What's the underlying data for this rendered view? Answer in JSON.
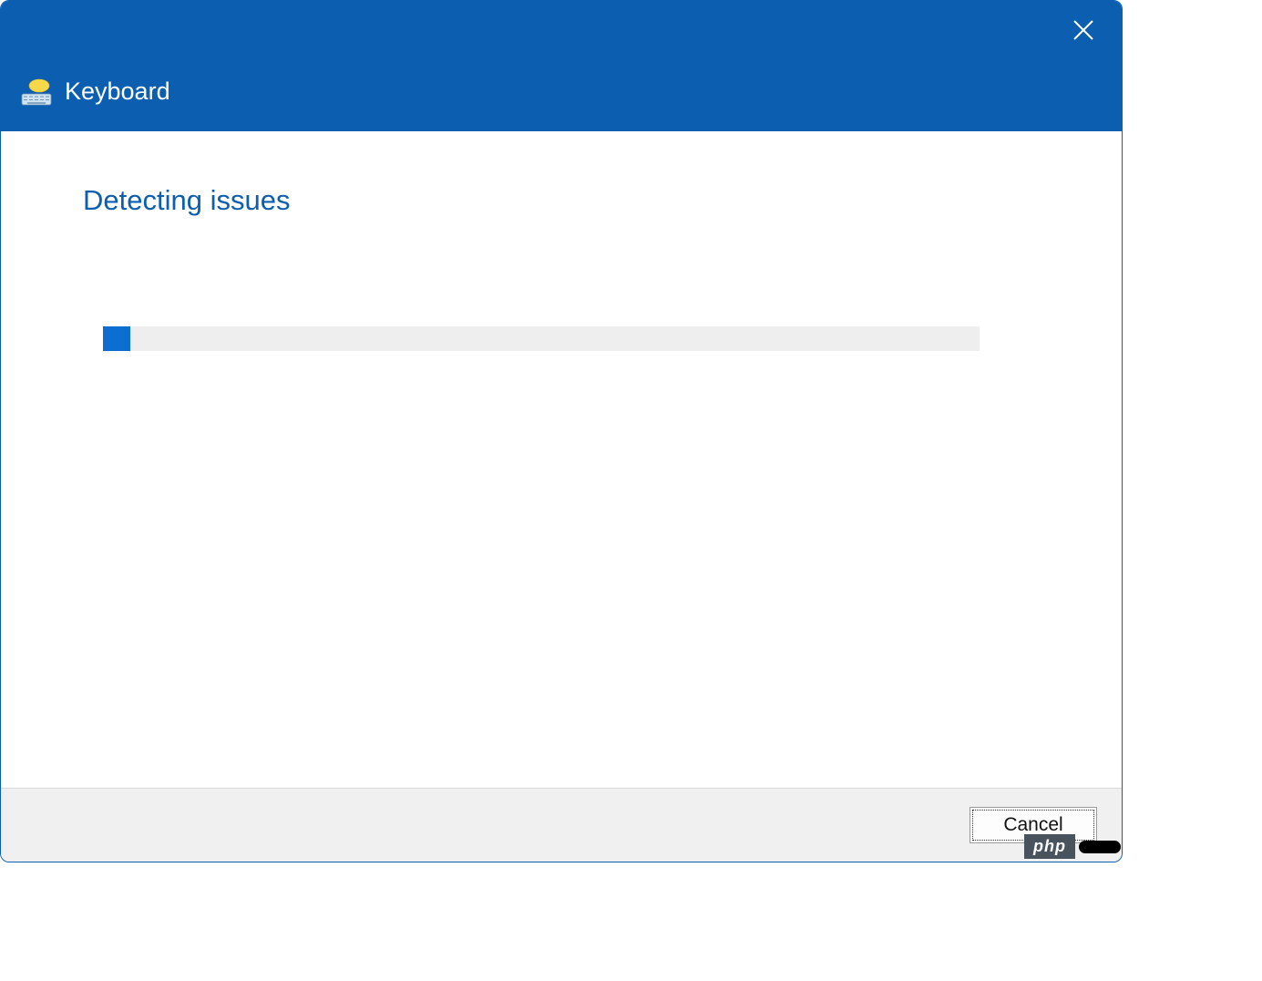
{
  "header": {
    "title": "Keyboard"
  },
  "content": {
    "heading": "Detecting issues"
  },
  "footer": {
    "cancel_label": "Cancel"
  },
  "watermark": {
    "label": "php"
  },
  "colors": {
    "accent": "#0b5eb0",
    "progress_fill": "#0c6ed1",
    "progress_track": "#eeeeee",
    "footer_bg": "#f0f0f0"
  }
}
